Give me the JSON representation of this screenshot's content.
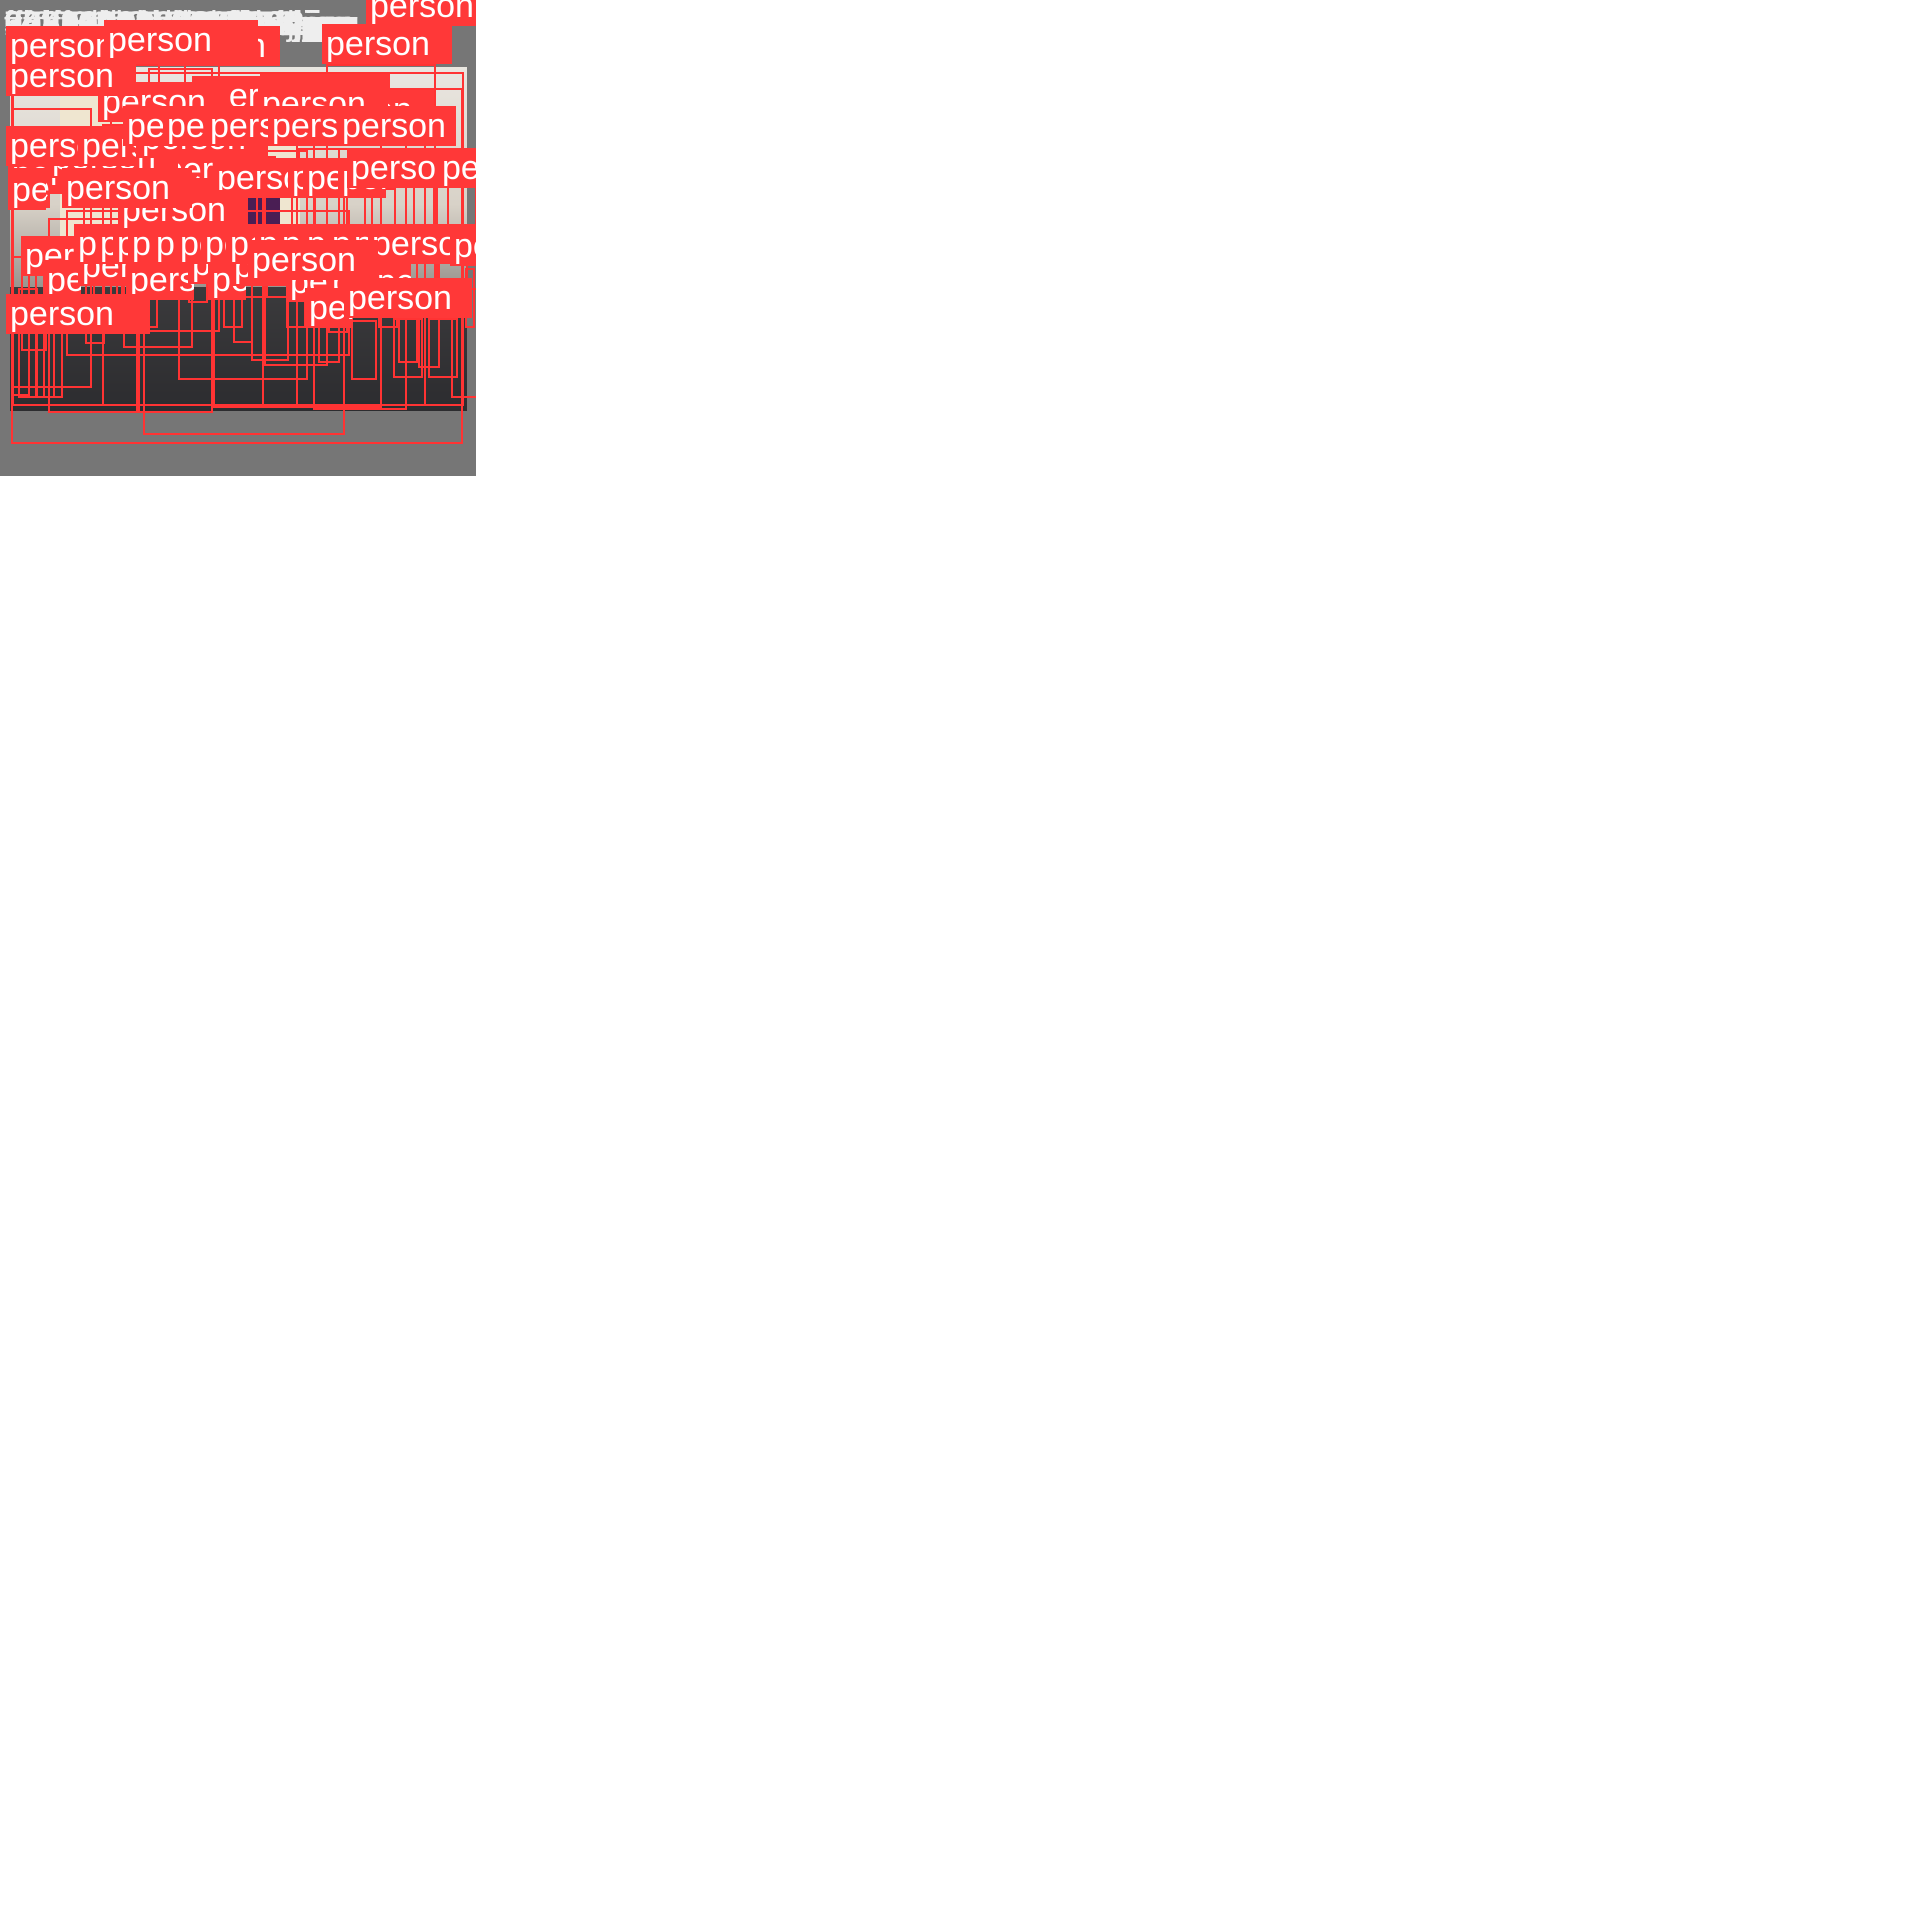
{
  "label_text": "person",
  "colors": {
    "tile_background": "#767676",
    "box": "#ff3333",
    "label_background": "#ff3838",
    "label_text": "#ffffff",
    "filename_text": "#eeeeee"
  },
  "tiles": [
    {
      "filename": "2aaf31065c31d7aa.jpg",
      "scene": "airplane cabin aisle, grayscale",
      "detections": 2
    },
    {
      "filename": "502ca3b69b90c382.jpg",
      "scene": "crowd in park under trees",
      "detections": 16
    },
    {
      "filename": "ff5b17e355394f3e.jpg",
      "scene": "people behind large red banner",
      "detections": 8
    },
    {
      "filename": "752a22acafb43152.jpg",
      "scene": "people along river embankment",
      "detections": 20
    },
    {
      "filename": "34c70802bc853686.jpg",
      "scene": "performers legs on confetti stage",
      "detections": 2
    },
    {
      "filename": "5ba91fe8a7c80bc5.jpg",
      "scene": "baby beside dark helmet",
      "detections": 1
    },
    {
      "filename": "978763ecc642c260.jpg",
      "scene": "performer on dark stage",
      "detections": 1
    },
    {
      "filename": "645e9c147117f4bf.jpg",
      "scene": "graduates and pipers",
      "detections": 6
    },
    {
      "filename": "3b406a0fa63086e8.jpg",
      "scene": "statue silhouette against sky",
      "detections": 1
    },
    {
      "filename": "5c271531d5ab1582.jpg",
      "scene": "theater audience from above",
      "detections": 2
    },
    {
      "filename": "9221abebc233d5ae.jpg",
      "scene": "boy beside model railway",
      "detections": 1
    },
    {
      "filename": "f70fadd092d24dc8.jpg",
      "scene": "fire hoop performer",
      "detections": 1
    },
    {
      "filename": "3fd06ec855e6a2a1.jpg",
      "scene": "guitarist under stage lights",
      "detections": 1
    },
    {
      "filename": "65c1c444b09c8b5c.jpg",
      "scene": "nurse doll in red case",
      "detections": 1
    },
    {
      "filename": "6b3359a95ae518c4.jpg",
      "scene": "wargame table with players",
      "detections": 8
    },
    {
      "filename": "35d4c4526811f0bf.jpg",
      "scene": "crowd around exhibit booth",
      "detections": 4
    }
  ]
}
